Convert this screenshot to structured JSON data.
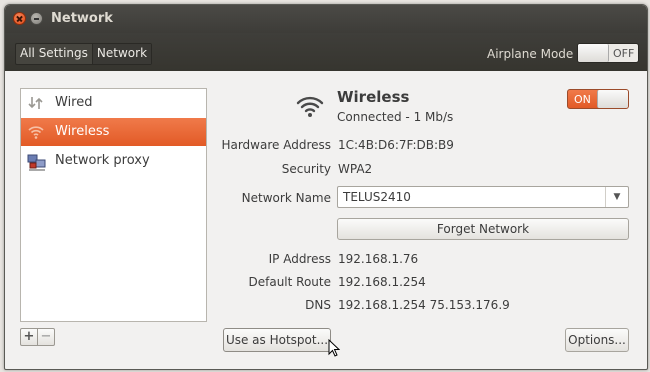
{
  "window": {
    "title": "Network"
  },
  "breadcrumb": {
    "all_settings": "All Settings",
    "network": "Network"
  },
  "airplane_mode": {
    "label": "Airplane Mode",
    "state": "OFF"
  },
  "sidebar": {
    "items": [
      {
        "label": "Wired",
        "icon": "network-wired-icon",
        "selected": false
      },
      {
        "label": "Wireless",
        "icon": "wifi-icon",
        "selected": true
      },
      {
        "label": "Network proxy",
        "icon": "network-proxy-icon",
        "selected": false
      }
    ],
    "add_label": "+",
    "remove_label": "−"
  },
  "wireless": {
    "title": "Wireless",
    "status": "Connected - 1 Mb/s",
    "switch_state": "ON"
  },
  "details": {
    "hardware_address": {
      "label": "Hardware Address",
      "value": "1C:4B:D6:7F:DB:B9"
    },
    "security": {
      "label": "Security",
      "value": "WPA2"
    },
    "network_name": {
      "label": "Network Name",
      "value": "TELUS2410"
    },
    "ip_address": {
      "label": "IP Address",
      "value": "192.168.1.76"
    },
    "default_route": {
      "label": "Default Route",
      "value": "192.168.1.254"
    },
    "dns": {
      "label": "DNS",
      "value": "192.168.1.254 75.153.176.9"
    }
  },
  "buttons": {
    "forget": "Forget Network",
    "hotspot": "Use as Hotspot...",
    "options": "Options..."
  },
  "colors": {
    "accent": "#e9612c",
    "titlebar": "#3d3c38"
  }
}
